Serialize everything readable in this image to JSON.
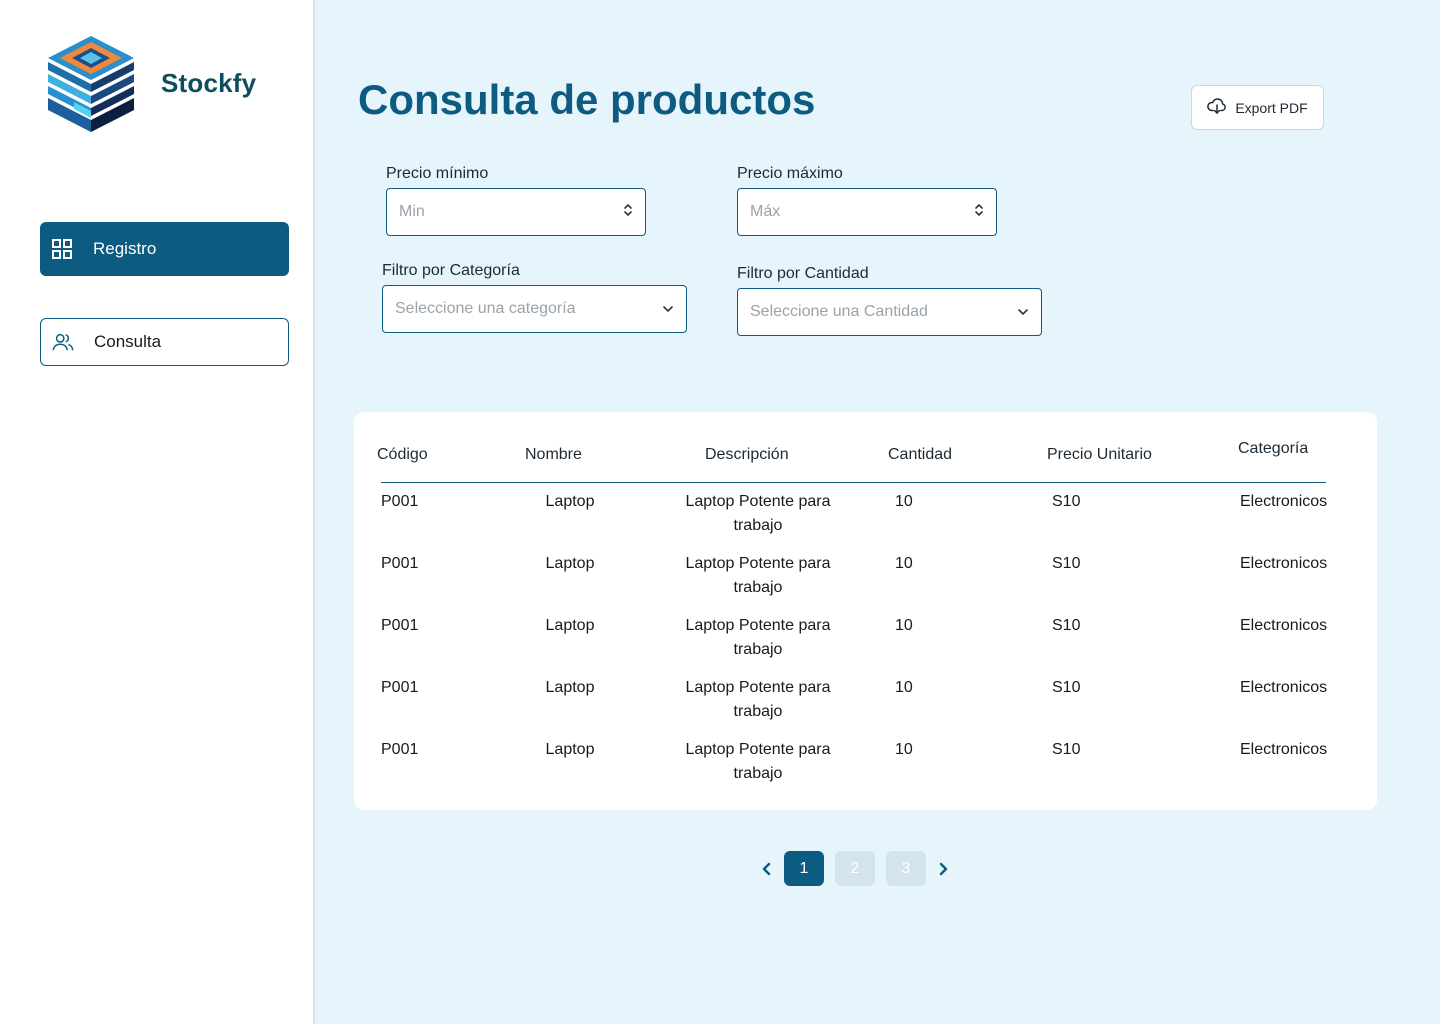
{
  "app": {
    "name": "Stockfy"
  },
  "sidebar": {
    "items": [
      {
        "label": "Registro",
        "icon": "grid-icon",
        "active": true
      },
      {
        "label": "Consulta",
        "icon": "users-icon",
        "active": false
      }
    ]
  },
  "header": {
    "title": "Consulta de productos",
    "export_label": "Export PDF",
    "export_icon": "cloud-download-icon"
  },
  "filters": {
    "min_price": {
      "label": "Precio mínimo",
      "placeholder": "Min"
    },
    "max_price": {
      "label": "Precio máximo",
      "placeholder": "Máx"
    },
    "category": {
      "label": "Filtro por Categoría",
      "placeholder": "Seleccione una categoría"
    },
    "quantity": {
      "label": "Filtro por Cantidad",
      "placeholder": "Seleccione una Cantidad"
    }
  },
  "table": {
    "columns": [
      "Código",
      "Nombre",
      "Descripción",
      "Cantidad",
      "Precio Unitario",
      "Categoría"
    ],
    "rows": [
      {
        "code": "P001",
        "name": "Laptop",
        "desc_1": "Laptop Potente para",
        "desc_2": "trabajo",
        "qty": "10",
        "price": "S10",
        "category": "Electronicos"
      },
      {
        "code": "P001",
        "name": "Laptop",
        "desc_1": "Laptop Potente para",
        "desc_2": "trabajo",
        "qty": "10",
        "price": "S10",
        "category": "Electronicos"
      },
      {
        "code": "P001",
        "name": "Laptop",
        "desc_1": "Laptop Potente para",
        "desc_2": "trabajo",
        "qty": "10",
        "price": "S10",
        "category": "Electronicos"
      },
      {
        "code": "P001",
        "name": "Laptop",
        "desc_1": "Laptop Potente para",
        "desc_2": "trabajo",
        "qty": "10",
        "price": "S10",
        "category": "Electronicos"
      },
      {
        "code": "P001",
        "name": "Laptop",
        "desc_1": "Laptop Potente para",
        "desc_2": "trabajo",
        "qty": "10",
        "price": "S10",
        "category": "Electronicos"
      }
    ]
  },
  "pagination": {
    "pages": [
      "1",
      "2",
      "3"
    ],
    "current": "1"
  },
  "colors": {
    "primary": "#0d5b80",
    "background": "#e6f4fc",
    "brand_text": "#0e4d5e"
  }
}
